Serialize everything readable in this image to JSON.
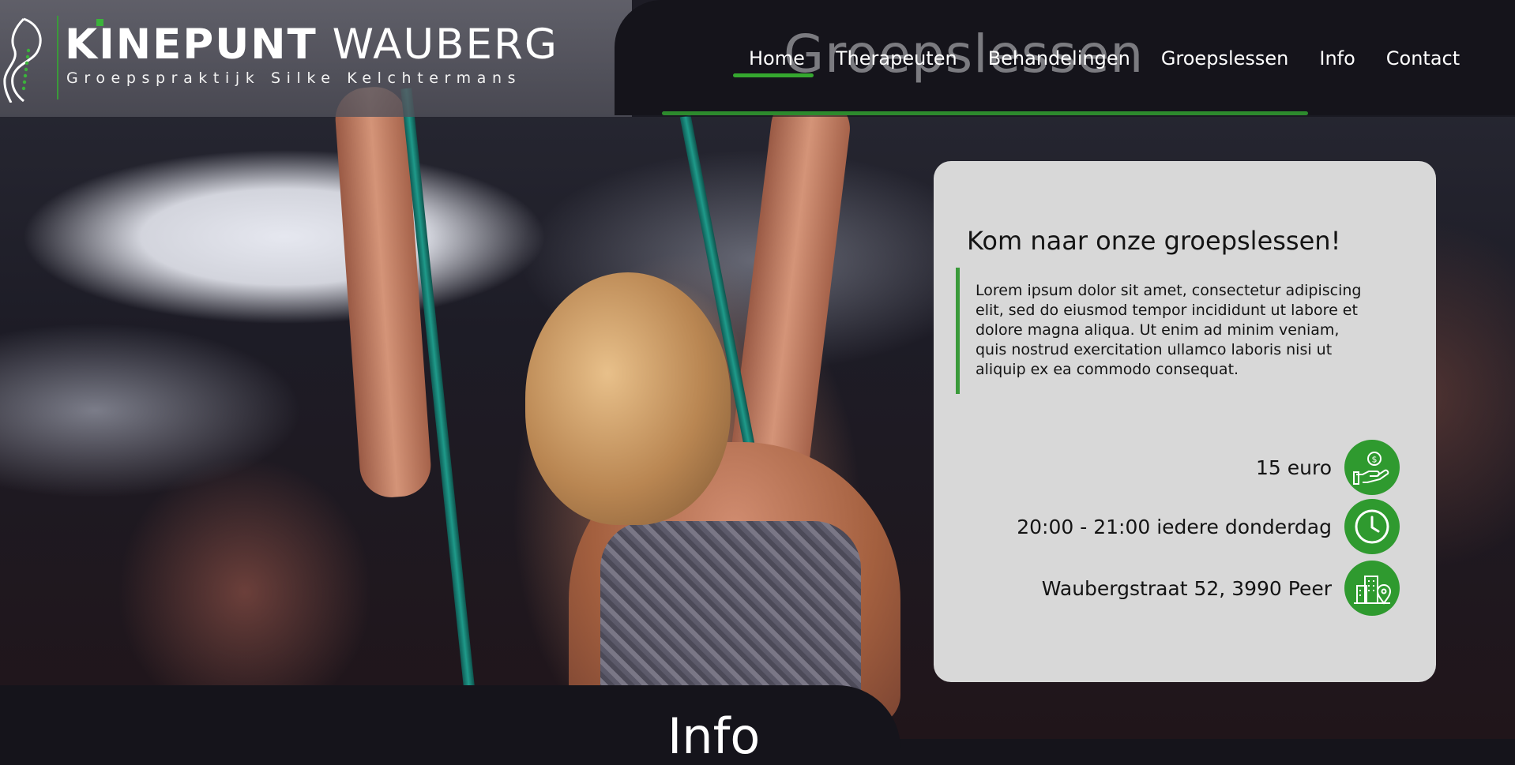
{
  "header": {
    "logo_title_bold": "KINEPUNT",
    "logo_title_thin": "WAUBERG",
    "logo_subtitle": "Groepspraktijk Silke Kelchtermans",
    "page_watermark": "Groepslessen",
    "nav": [
      {
        "label": "Home",
        "active": true
      },
      {
        "label": "Therapeuten"
      },
      {
        "label": "Behandelingen"
      },
      {
        "label": "Groepslessen"
      },
      {
        "label": "Info"
      },
      {
        "label": "Contact"
      }
    ]
  },
  "card": {
    "title": "Kom naar onze groepslessen!",
    "body": "Lorem ipsum dolor sit amet, consectetur adipiscing elit, sed do eiusmod tempor incididunt ut labore et dolore magna aliqua. Ut enim ad minim veniam, quis nostrud exercitation ullamco laboris nisi ut aliquip ex ea commodo consequat.",
    "rows": [
      {
        "text": "15 euro",
        "icon": "money-hand-icon"
      },
      {
        "text": "20:00 - 21:00 iedere donderdag",
        "icon": "clock-icon"
      },
      {
        "text": "Waubergstraat 52, 3990 Peer",
        "icon": "building-location-icon"
      }
    ]
  },
  "section": {
    "title": "Info"
  },
  "colors": {
    "accent_green": "#2f9a2f",
    "dark_bg": "#15141b",
    "card_bg": "#d8d8d8"
  }
}
